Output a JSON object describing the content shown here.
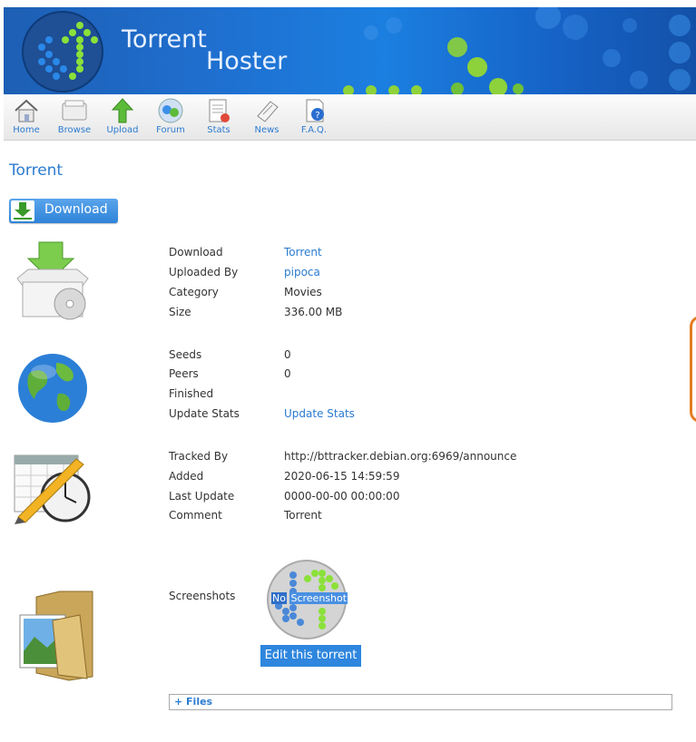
{
  "header": {
    "title_line1": "Torrent",
    "title_line2": "Hoster"
  },
  "nav": {
    "items": [
      {
        "label": "Home",
        "icon": "home-icon"
      },
      {
        "label": "Browse",
        "icon": "browse-icon"
      },
      {
        "label": "Upload",
        "icon": "upload-icon"
      },
      {
        "label": "Forum",
        "icon": "forum-icon"
      },
      {
        "label": "Stats",
        "icon": "stats-icon"
      },
      {
        "label": "News",
        "icon": "news-icon"
      },
      {
        "label": "F.A.Q.",
        "icon": "faq-icon"
      }
    ]
  },
  "page": {
    "title": "Torrent",
    "download_button": "Download"
  },
  "details": {
    "file": [
      {
        "label": "Download",
        "value": "Torrent"
      },
      {
        "label": "Uploaded By",
        "value": "pipoca"
      },
      {
        "label": "Category",
        "value": "Movies"
      },
      {
        "label": "Size",
        "value": "336.00 MB"
      }
    ],
    "peers": [
      {
        "label": "Seeds",
        "value": "0"
      },
      {
        "label": "Peers",
        "value": "0"
      },
      {
        "label": "Finished",
        "value": ""
      },
      {
        "label": "Update Stats",
        "value": "Update Stats"
      }
    ],
    "tracking": [
      {
        "label": "Tracked By",
        "value": "http://bttracker.debian.org:6969/announce"
      },
      {
        "label": "Added",
        "value": "2020-06-15 14:59:59"
      },
      {
        "label": "Last Update",
        "value": "0000-00-00 00:00:00"
      },
      {
        "label": "Comment",
        "value": "Torrent"
      }
    ]
  },
  "screenshots": {
    "label": "Screenshots",
    "placeholder_no": "No",
    "placeholder_text": "Screenshot",
    "edit_button": "Edit this torrent"
  },
  "files": {
    "toggle": "+ Files"
  },
  "colors": {
    "accent": "#2c7bd0",
    "banner": "#1b6fd0",
    "edit_button": "#2e86de"
  }
}
